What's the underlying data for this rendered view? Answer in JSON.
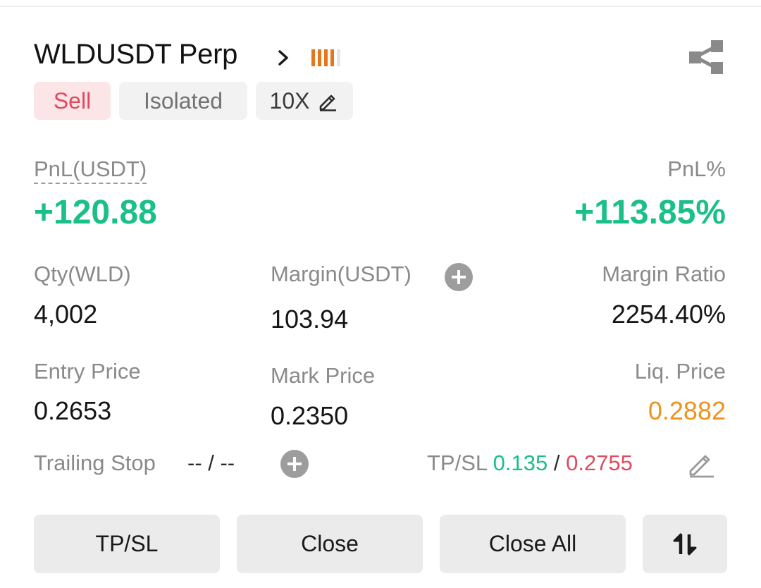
{
  "position": {
    "symbol": "WLDUSDT Perp",
    "side": "Sell",
    "margin_mode": "Isolated",
    "leverage": "10X",
    "signal_bars": {
      "filled": 4,
      "total": 5,
      "color": "#e8751a"
    }
  },
  "icons": {
    "chevron": "chevron-right-icon",
    "signal": "signal-bars-icon",
    "share": "share-icon",
    "edit": "pencil-icon",
    "add": "plus-circle-icon",
    "swap": "swap-vertical-icon"
  },
  "pnl": {
    "label": "PnL(USDT)",
    "value": "+120.88",
    "pct_label": "PnL%",
    "pct_value": "+113.85%"
  },
  "stats": {
    "qty_label": "Qty(WLD)",
    "qty_value": "4,002",
    "margin_label": "Margin(USDT)",
    "margin_value": "103.94",
    "margin_ratio_label": "Margin Ratio",
    "margin_ratio_value": "2254.40%",
    "entry_label": "Entry Price",
    "entry_value": "0.2653",
    "mark_label": "Mark Price",
    "mark_value": "0.2350",
    "liq_label": "Liq. Price",
    "liq_value": "0.2882"
  },
  "trailing": {
    "label": "Trailing Stop",
    "value": "-- / --"
  },
  "tpsl": {
    "label": "TP/SL",
    "tp": "0.135",
    "separator": "/",
    "sl": "0.2755"
  },
  "buttons": {
    "tpsl": "TP/SL",
    "close": "Close",
    "close_all": "Close All"
  },
  "colors": {
    "profit_green": "#1bbf88",
    "sell_red": "#e04a5f",
    "liq_orange": "#f0921a"
  }
}
